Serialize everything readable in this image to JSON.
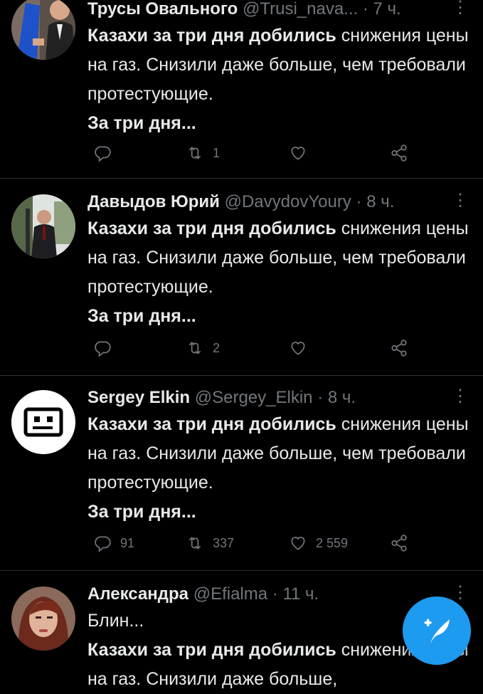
{
  "tweets": [
    {
      "name": "Трусы Овального",
      "handle": "@Trusi_nava...",
      "sep": "·",
      "time": "7 ч.",
      "pre": "",
      "bold1": "Казахи за три дня добились",
      "rest1": " снижения цены на газ. Снизили даже больше, чем требовали протестующие.",
      "bold2": "За три дня...",
      "replies": "",
      "retweets": "1",
      "likes": ""
    },
    {
      "name": "Давыдов Юрий",
      "handle": "@DavydovYoury",
      "sep": "·",
      "time": "8 ч.",
      "pre": "",
      "bold1": "Казахи за три дня добились",
      "rest1": " снижения цены на газ. Снизили даже больше, чем требовали протестующие.",
      "bold2": "За три дня...",
      "replies": "",
      "retweets": "2",
      "likes": ""
    },
    {
      "name": "Sergey Elkin",
      "handle": "@Sergey_Elkin",
      "sep": "·",
      "time": "8 ч.",
      "pre": "",
      "bold1": "Казахи за три дня добились",
      "rest1": " снижения цены на газ. Снизили даже больше, чем требовали протестующие.",
      "bold2": "За три дня...",
      "replies": "91",
      "retweets": "337",
      "likes": "2 559"
    },
    {
      "name": "Александра",
      "handle": "@Efialma",
      "sep": "·",
      "time": "11 ч.",
      "pre": "Блин...",
      "bold1": "Казахи за три дня добились",
      "rest1": " снижения цены на газ. Снизили даже больше,",
      "bold2": "",
      "replies": "",
      "retweets": "",
      "likes": ""
    }
  ],
  "icons": {
    "more": "more-icon",
    "reply": "reply-icon",
    "retweet": "retweet-icon",
    "like": "heart-icon",
    "share": "share-icon",
    "compose": "compose-tweet-icon"
  },
  "colors": {
    "background": "#000000",
    "text": "#e7e9ea",
    "secondary": "#71767b",
    "accent": "#1d9bf0",
    "divider": "#2f3336"
  }
}
